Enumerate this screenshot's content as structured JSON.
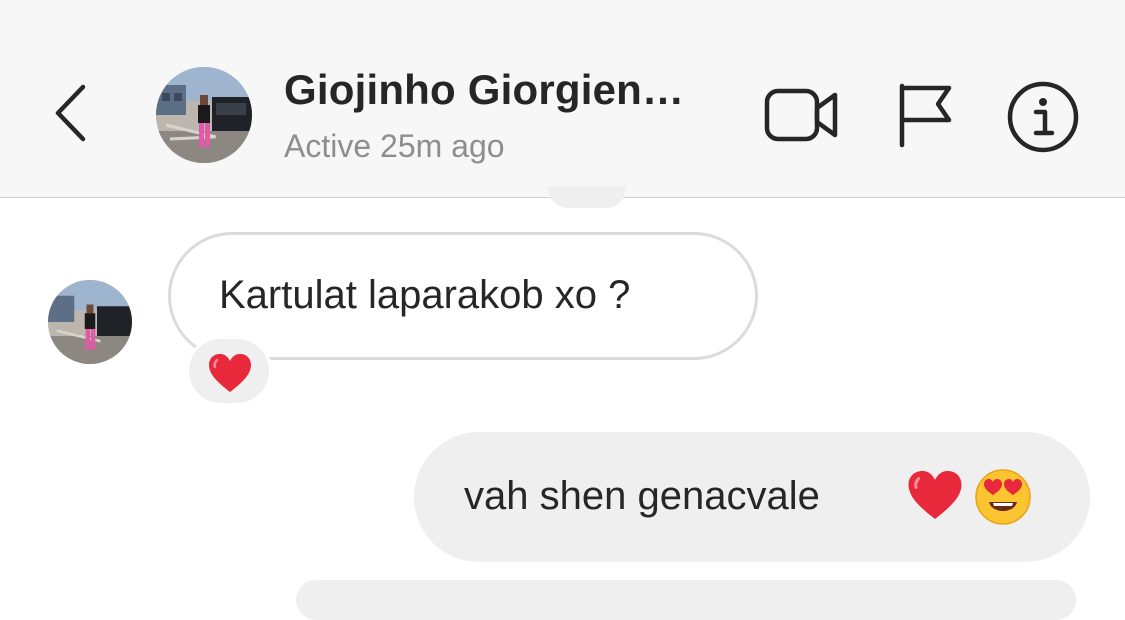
{
  "header": {
    "contact_name": "Giojinho Giorgien…",
    "status": "Active 25m ago",
    "icons": [
      "back-chevron-icon",
      "video-call-icon",
      "report-flag-icon",
      "info-icon"
    ]
  },
  "messages": [
    {
      "direction": "incoming",
      "text": "Kartulat laparakob xo ?",
      "reaction": "red-heart-emoji"
    },
    {
      "direction": "outgoing",
      "text": "vah shen genacvale",
      "emojis": [
        "red-heart-emoji",
        "heart-eyes-emoji"
      ]
    }
  ],
  "colors": {
    "header_bg": "#f7f7f7",
    "outgoing_bubble": "#efefef",
    "incoming_border": "#dbdbdb",
    "status_text": "#8e8e8e",
    "heart": "#e8283b"
  }
}
